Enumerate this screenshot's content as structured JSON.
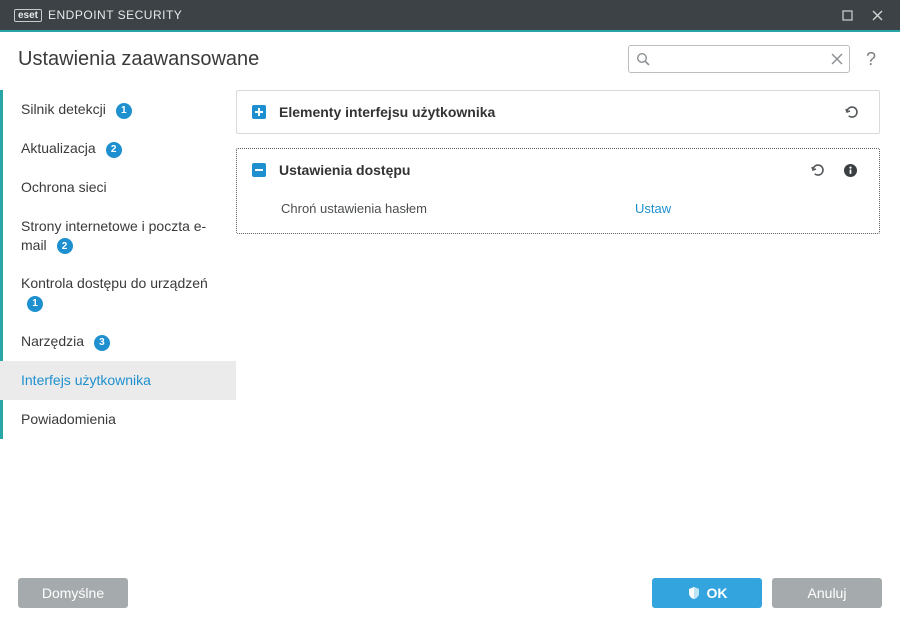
{
  "titlebar": {
    "brand_logo": "eset",
    "brand_text": "ENDPOINT SECURITY"
  },
  "header": {
    "title": "Ustawienia zaawansowane"
  },
  "search": {
    "placeholder": "",
    "value": ""
  },
  "sidebar": {
    "items": [
      {
        "label": "Silnik detekcji",
        "badge": "1",
        "selected": false
      },
      {
        "label": "Aktualizacja",
        "badge": "2",
        "selected": false
      },
      {
        "label": "Ochrona sieci",
        "badge": null,
        "selected": false
      },
      {
        "label": "Strony internetowe i poczta e-mail",
        "badge": "2",
        "selected": false
      },
      {
        "label": "Kontrola dostępu do urządzeń",
        "badge": "1",
        "selected": false
      },
      {
        "label": "Narzędzia",
        "badge": "3",
        "selected": false
      },
      {
        "label": "Interfejs użytkownika",
        "badge": null,
        "selected": true
      },
      {
        "label": "Powiadomienia",
        "badge": null,
        "selected": false
      }
    ]
  },
  "panels": [
    {
      "key": "ui-elements",
      "title": "Elementy interfejsu użytkownika",
      "expanded": false
    },
    {
      "key": "access-settings",
      "title": "Ustawienia dostępu",
      "expanded": true,
      "rows": [
        {
          "label": "Chroń ustawienia hasłem",
          "action": "Ustaw"
        }
      ]
    }
  ],
  "footer": {
    "defaults": "Domyślne",
    "ok": "OK",
    "cancel": "Anuluj"
  }
}
